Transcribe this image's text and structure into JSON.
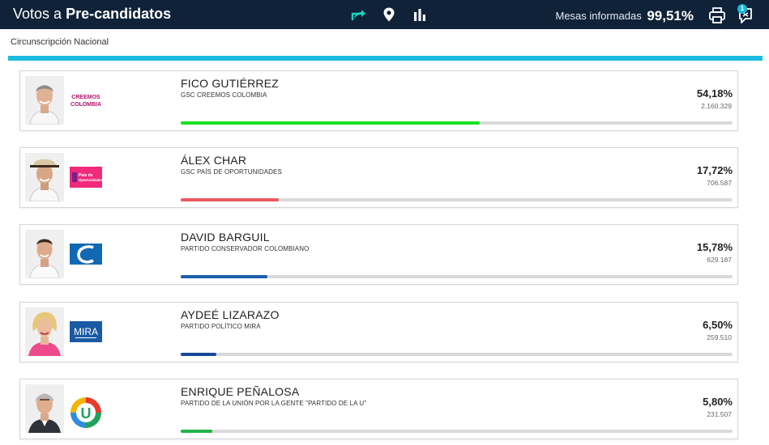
{
  "header": {
    "title_prefix": "Votos a",
    "title_bold": "Pre-candidatos",
    "mesas_label": "Mesas informadas",
    "mesas_value": "99,51%",
    "notification_count": "1",
    "icons": [
      "share-icon",
      "location-pin-icon",
      "bar-chart-icon",
      "print-icon",
      "chat-icon"
    ],
    "bg_color": "#0f2238",
    "accent_color": "#1cbbe0"
  },
  "circunscripcion": "Circunscripción Nacional",
  "candidates": [
    {
      "name": "FICO GUTIÉRREZ",
      "party": "GSC CREEMOS COLOMBIA",
      "percent": "54,18%",
      "votes": "2.160.329",
      "share": 54.18,
      "bar_color": "#18e11e",
      "logo_text": "CREEMOS\nCOLOMBIA"
    },
    {
      "name": "ÁLEX CHAR",
      "party": "GSC PAÍS DE OPORTUNIDADES",
      "percent": "17,72%",
      "votes": "706.587",
      "share": 17.72,
      "bar_color": "#ec5a61",
      "logo_text": "País de Oportunidades"
    },
    {
      "name": "DAVID BARGUIL",
      "party": "PARTIDO CONSERVADOR COLOMBIANO",
      "percent": "15,78%",
      "votes": "629.187",
      "share": 15.78,
      "bar_color": "#1b5fa8",
      "logo_text": "C"
    },
    {
      "name": "AYDEÉ LIZARAZO",
      "party": "PARTIDO POLÍTICO MIRA",
      "percent": "6,50%",
      "votes": "259.510",
      "share": 6.5,
      "bar_color": "#144a96",
      "logo_text": "MIRA"
    },
    {
      "name": "ENRIQUE PEÑALOSA",
      "party": "PARTIDO DE LA UNIÓN POR LA GENTE \"PARTIDO DE LA U\"",
      "percent": "5,80%",
      "votes": "231.507",
      "share": 5.8,
      "bar_color": "#22b24a",
      "logo_text": "U"
    }
  ]
}
